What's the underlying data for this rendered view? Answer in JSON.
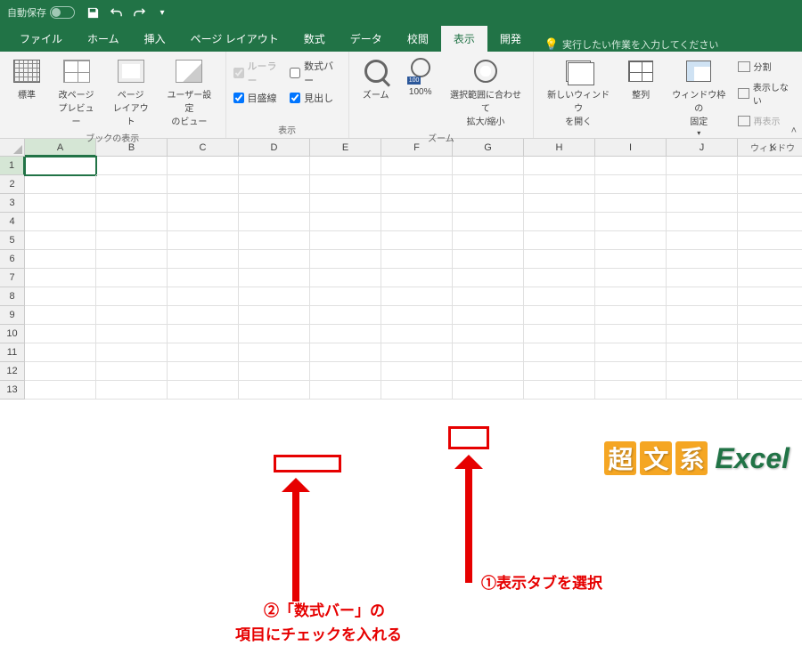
{
  "titlebar": {
    "autosave_label": "自動保存",
    "autosave_state": "オフ"
  },
  "tabs": {
    "file": "ファイル",
    "home": "ホーム",
    "insert": "挿入",
    "page_layout": "ページ レイアウト",
    "formulas": "数式",
    "data": "データ",
    "review": "校閲",
    "view": "表示",
    "developer": "開発"
  },
  "tellme": "実行したい作業を入力してください",
  "ribbon": {
    "views": {
      "normal": "標準",
      "pagebreak": "改ページ\nプレビュー",
      "pagelayout": "ページ\nレイアウト",
      "custom": "ユーザー設定\nのビュー",
      "group_label": "ブックの表示"
    },
    "show": {
      "ruler": "ルーラー",
      "formula_bar": "数式バー",
      "gridlines": "目盛線",
      "headings": "見出し",
      "group_label": "表示"
    },
    "zoom": {
      "zoom": "ズーム",
      "hundred": "100%",
      "fit": "選択範囲に合わせて\n拡大/縮小",
      "group_label": "ズーム"
    },
    "window": {
      "new_window": "新しいウィンドウ\nを開く",
      "arrange": "整列",
      "freeze": "ウィンドウ枠の\n固定",
      "split": "分割",
      "hide": "表示しない",
      "unhide": "再表示",
      "group_label": "ウィンドウ"
    }
  },
  "columns": [
    "A",
    "B",
    "C",
    "D",
    "E",
    "F",
    "G",
    "H",
    "I",
    "J",
    "K"
  ],
  "rows": [
    "1",
    "2",
    "3",
    "4",
    "5",
    "6",
    "7",
    "8",
    "9",
    "10",
    "11",
    "12",
    "13"
  ],
  "annotations": {
    "step1": "①表示タブを選択",
    "step2a": "②「数式バー」の",
    "step2b": "項目にチェックを入れる"
  },
  "watermark": {
    "c1": "超",
    "c2": "文",
    "c3": "系",
    "excel": "Excel"
  }
}
